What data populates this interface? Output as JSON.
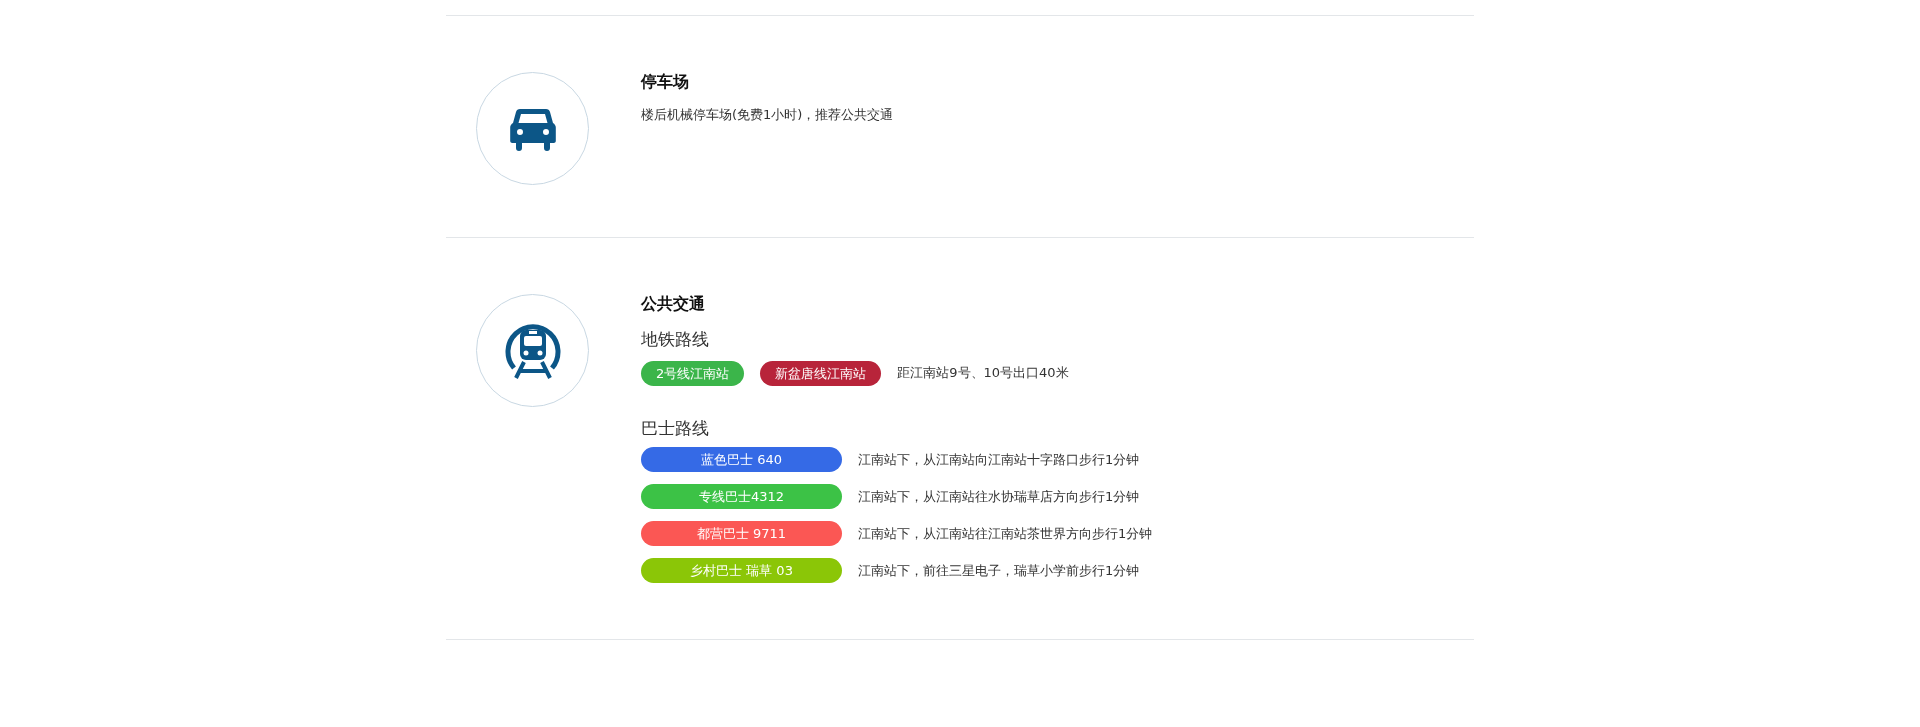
{
  "sections": [
    {
      "kind": "parking",
      "title": "停车场",
      "description": "楼后机械停车场(免费1小时)，推荐公共交通"
    },
    {
      "kind": "transit",
      "title": "公共交通",
      "subway": {
        "heading": "地铁路线",
        "lines": [
          {
            "label": "2号线江南站",
            "color": "#3bb54a"
          },
          {
            "label": "新盆唐线江南站",
            "color": "#b8243a"
          }
        ],
        "note": "距江南站9号、10号出口40米"
      },
      "bus": {
        "heading": "巴士路线",
        "routes": [
          {
            "label": "蓝色巴士 640",
            "color": "#356ae6",
            "note": "江南站下，从江南站向江南站十字路口步行1分钟"
          },
          {
            "label": "专线巴士4312",
            "color": "#3cc246",
            "note": "江南站下，从江南站往水协瑞草店方向步行1分钟"
          },
          {
            "label": "都营巴士 9711",
            "color": "#fb5754",
            "note": "江南站下，从江南站往江南站茶世界方向步行1分钟"
          },
          {
            "label": "乡村巴士 瑞草 03",
            "color": "#8bc607",
            "note": "江南站下，前往三星电子，瑞草小学前步行1分钟"
          }
        ]
      }
    }
  ]
}
